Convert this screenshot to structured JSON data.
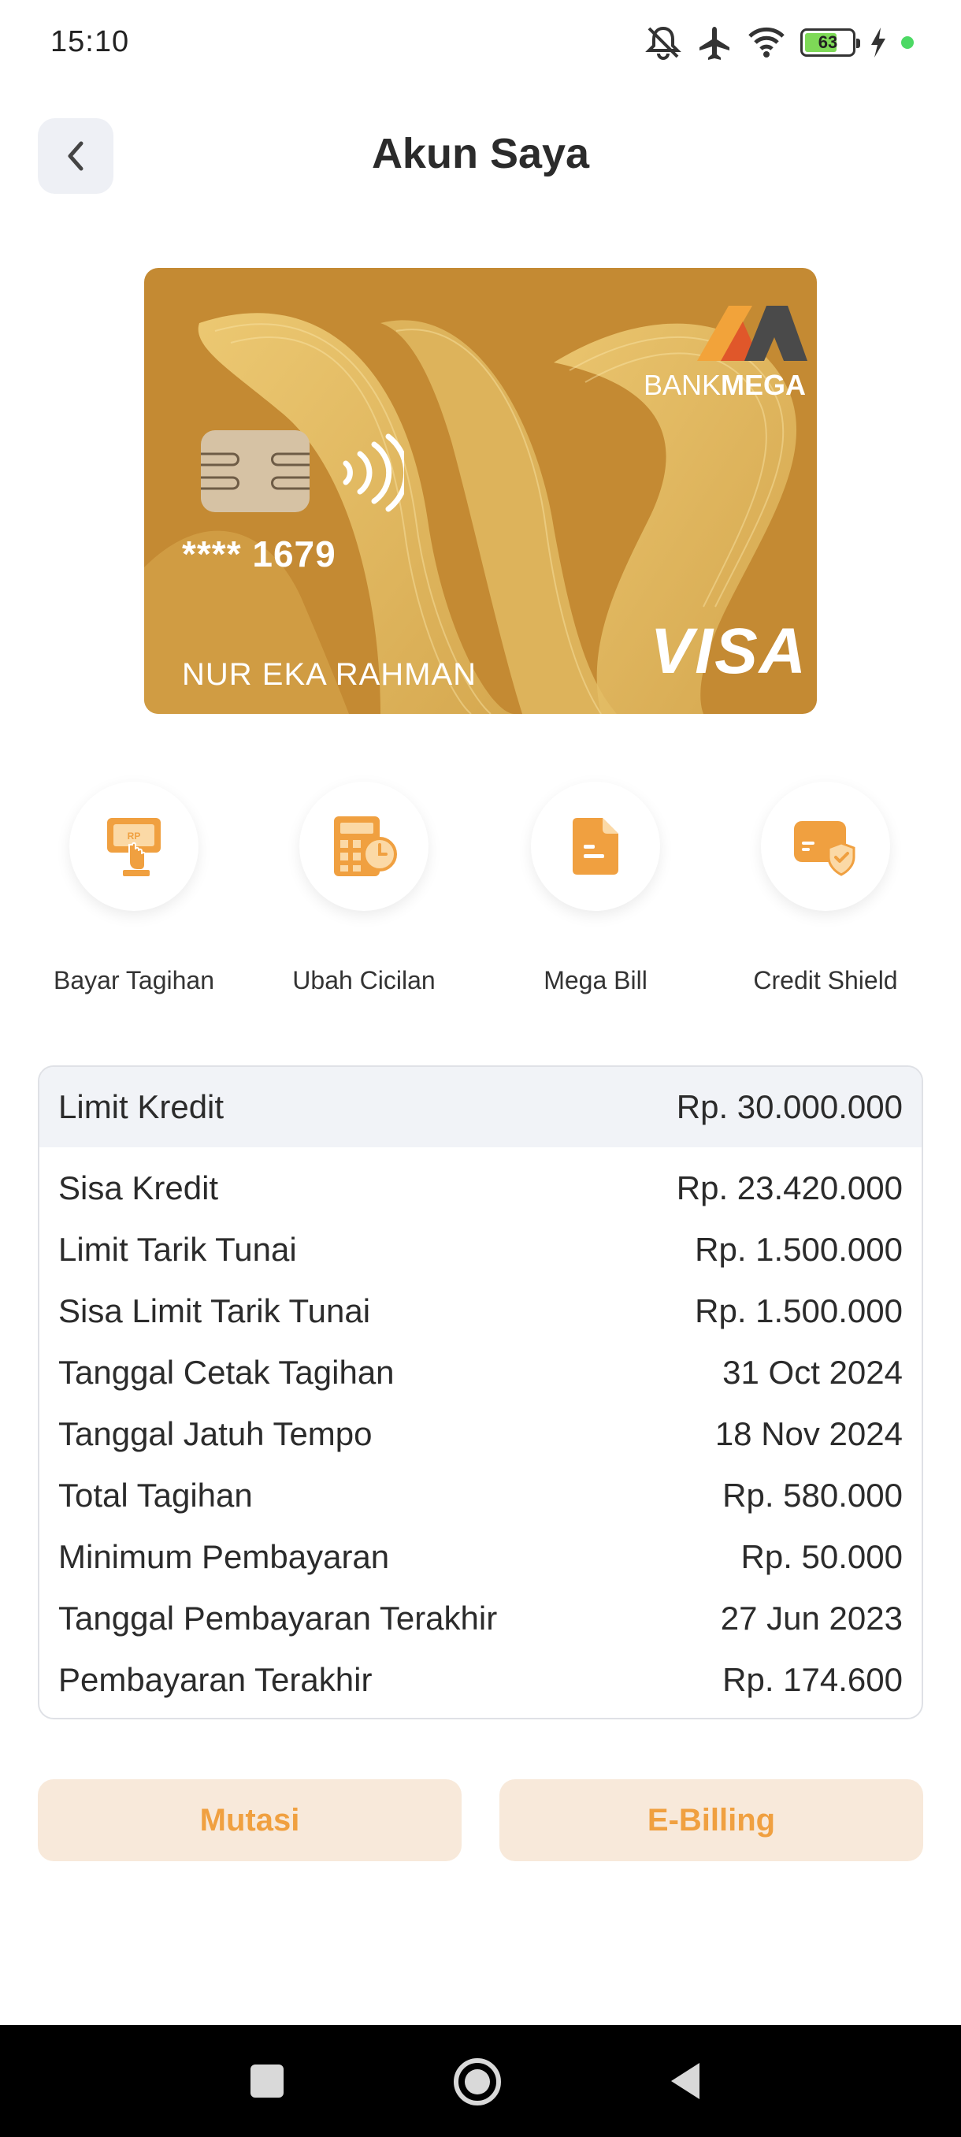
{
  "status_bar": {
    "time": "15:10",
    "battery": "63",
    "icons": [
      "mute-icon",
      "airplane-icon",
      "wifi-icon",
      "battery-icon",
      "charging-icon",
      "dot-icon"
    ]
  },
  "header": {
    "title": "Akun Saya",
    "back_icon": "chevron-left-icon"
  },
  "card": {
    "bank_name_light": "BANK",
    "bank_name_bold": "MEGA",
    "number": "**** 1679",
    "holder": "NUR EKA RAHMAN",
    "network": "VISA",
    "color": "#c48a33"
  },
  "actions": [
    {
      "label": "Bayar Tagihan",
      "icon": "bill-payment-icon"
    },
    {
      "label": "Ubah Cicilan",
      "icon": "calculator-icon"
    },
    {
      "label": "Mega Bill",
      "icon": "document-icon"
    },
    {
      "label": "Credit Shield",
      "icon": "card-shield-icon"
    }
  ],
  "info": {
    "header": {
      "label": "Limit Kredit",
      "value": "Rp. 30.000.000"
    },
    "rows": [
      {
        "label": "Sisa Kredit",
        "value": "Rp. 23.420.000"
      },
      {
        "label": "Limit Tarik Tunai",
        "value": "Rp. 1.500.000"
      },
      {
        "label": "Sisa Limit Tarik Tunai",
        "value": "Rp. 1.500.000"
      },
      {
        "label": "Tanggal Cetak Tagihan",
        "value": "31 Oct 2024"
      },
      {
        "label": "Tanggal Jatuh Tempo",
        "value": "18 Nov 2024"
      },
      {
        "label": "Total Tagihan",
        "value": "Rp. 580.000"
      },
      {
        "label": "Minimum Pembayaran",
        "value": "Rp. 50.000"
      },
      {
        "label": "Tanggal Pembayaran Terakhir",
        "value": "27 Jun 2023"
      },
      {
        "label": "Pembayaran Terakhir",
        "value": "Rp. 174.600"
      }
    ]
  },
  "buttons": {
    "mutasi": "Mutasi",
    "ebilling": "E-Billing"
  },
  "colors": {
    "accent": "#f0a040",
    "button_bg": "#f8e9da",
    "panel_head": "#f1f3f7"
  },
  "navbar": {
    "icons": [
      "square-recents-icon",
      "circle-home-icon",
      "triangle-back-icon"
    ]
  }
}
